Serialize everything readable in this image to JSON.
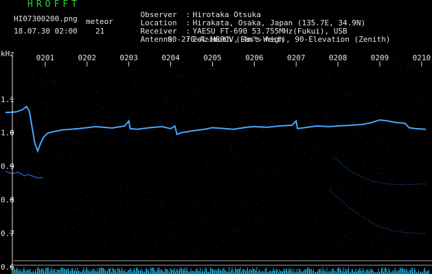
{
  "header": {
    "app_title": "HROFFT",
    "file_name": "HI07300200.png",
    "date_time": "18.07.30 02:00",
    "meteor_label": "meteor",
    "meteor_count": "21"
  },
  "station": {
    "observer": {
      "key": "Observer",
      "sep": ":",
      "value": "Hirotaka Otsuka"
    },
    "location": {
      "key": "Location",
      "sep": ":",
      "value": "Hirakata, Osaka, Japan (135.7E, 34.9N)"
    },
    "receiver": {
      "key": "Receiver",
      "sep": ":",
      "value": "YAESU FT-690 53.755MHz(Fukui), USB"
    },
    "antenna": {
      "key": "Antenna",
      "sep": ":",
      "value": "2el-HB9CV, 4m's high"
    },
    "antenna_line2": "90-270-Azimuth (East-West), 90-Elevation (Zenith)"
  },
  "chart_data": {
    "type": "line",
    "ylabel": "kHz",
    "y_ticks": [
      "1.1",
      "1.0",
      "0.9",
      "0.8",
      "0.7",
      "0.6"
    ],
    "y_tick_values": [
      1.1,
      1.0,
      0.9,
      0.8,
      0.7,
      0.6
    ],
    "ylim": [
      0.595,
      1.22
    ],
    "x_ticks": [
      "0201",
      "0202",
      "0203",
      "0204",
      "0205",
      "0206",
      "0207",
      "0208",
      "0209",
      "0210"
    ],
    "x_tick_values": [
      1,
      2,
      3,
      4,
      5,
      6,
      7,
      8,
      9,
      10
    ],
    "xlim": [
      0.05,
      10.1
    ],
    "grid": false,
    "reference_lines_khz": [
      0.618,
      0.605
    ],
    "colors": {
      "background": "#000000",
      "signal": "#4aa8ff",
      "faint_trace": "#2a5fb8",
      "noise": "#1c3a8c",
      "axis_text": "#e6e6e6",
      "title": "#2fd43a",
      "reference_line": "#c8c8c8",
      "bottom_noise": "#22c8ff"
    },
    "series": [
      {
        "points": [
          [
            0.05,
            1.06
          ],
          [
            0.3,
            1.062
          ],
          [
            0.45,
            1.068
          ],
          [
            0.55,
            1.078
          ],
          [
            0.62,
            1.065
          ],
          [
            0.68,
            1.02
          ],
          [
            0.75,
            0.97
          ],
          [
            0.82,
            0.945
          ],
          [
            0.88,
            0.965
          ],
          [
            0.95,
            0.985
          ],
          [
            1.05,
            0.998
          ],
          [
            1.2,
            1.003
          ],
          [
            1.4,
            1.008
          ],
          [
            1.6,
            1.01
          ],
          [
            1.8,
            1.012
          ],
          [
            2.0,
            1.015
          ],
          [
            2.2,
            1.018
          ],
          [
            2.4,
            1.016
          ],
          [
            2.6,
            1.014
          ],
          [
            2.8,
            1.018
          ],
          [
            2.9,
            1.02
          ],
          [
            3.0,
            1.035
          ],
          [
            3.03,
            1.012
          ],
          [
            3.2,
            1.01
          ],
          [
            3.5,
            1.015
          ],
          [
            3.8,
            1.018
          ],
          [
            4.0,
            1.012
          ],
          [
            4.1,
            1.02
          ],
          [
            4.15,
            0.995
          ],
          [
            4.25,
            1.0
          ],
          [
            4.5,
            1.005
          ],
          [
            4.8,
            1.01
          ],
          [
            5.0,
            1.015
          ],
          [
            5.3,
            1.012
          ],
          [
            5.5,
            1.01
          ],
          [
            5.8,
            1.016
          ],
          [
            6.0,
            1.018
          ],
          [
            6.3,
            1.016
          ],
          [
            6.6,
            1.02
          ],
          [
            6.9,
            1.022
          ],
          [
            7.0,
            1.035
          ],
          [
            7.03,
            1.012
          ],
          [
            7.2,
            1.015
          ],
          [
            7.5,
            1.02
          ],
          [
            7.8,
            1.018
          ],
          [
            8.0,
            1.02
          ],
          [
            8.3,
            1.022
          ],
          [
            8.6,
            1.025
          ],
          [
            8.8,
            1.03
          ],
          [
            9.0,
            1.038
          ],
          [
            9.2,
            1.035
          ],
          [
            9.4,
            1.03
          ],
          [
            9.6,
            1.028
          ],
          [
            9.7,
            1.015
          ],
          [
            9.85,
            1.012
          ],
          [
            10.1,
            1.01
          ]
        ]
      },
      {
        "points": [
          [
            0.05,
            0.885
          ],
          [
            0.2,
            0.878
          ],
          [
            0.35,
            0.882
          ],
          [
            0.5,
            0.872
          ],
          [
            0.6,
            0.875
          ],
          [
            0.75,
            0.868
          ],
          [
            0.85,
            0.865
          ],
          [
            0.95,
            0.866
          ]
        ]
      },
      {
        "points": [
          [
            7.9,
            0.93
          ],
          [
            8.1,
            0.905
          ],
          [
            8.3,
            0.885
          ],
          [
            8.6,
            0.866
          ],
          [
            8.9,
            0.853
          ],
          [
            9.2,
            0.847
          ],
          [
            9.5,
            0.845
          ],
          [
            9.8,
            0.846
          ],
          [
            10.1,
            0.847
          ]
        ]
      },
      {
        "points": [
          [
            7.8,
            0.83
          ],
          [
            8.1,
            0.795
          ],
          [
            8.4,
            0.765
          ],
          [
            8.7,
            0.74
          ],
          [
            9.0,
            0.72
          ],
          [
            9.3,
            0.708
          ],
          [
            9.6,
            0.702
          ],
          [
            9.9,
            0.7
          ],
          [
            10.1,
            0.7
          ]
        ]
      }
    ]
  }
}
